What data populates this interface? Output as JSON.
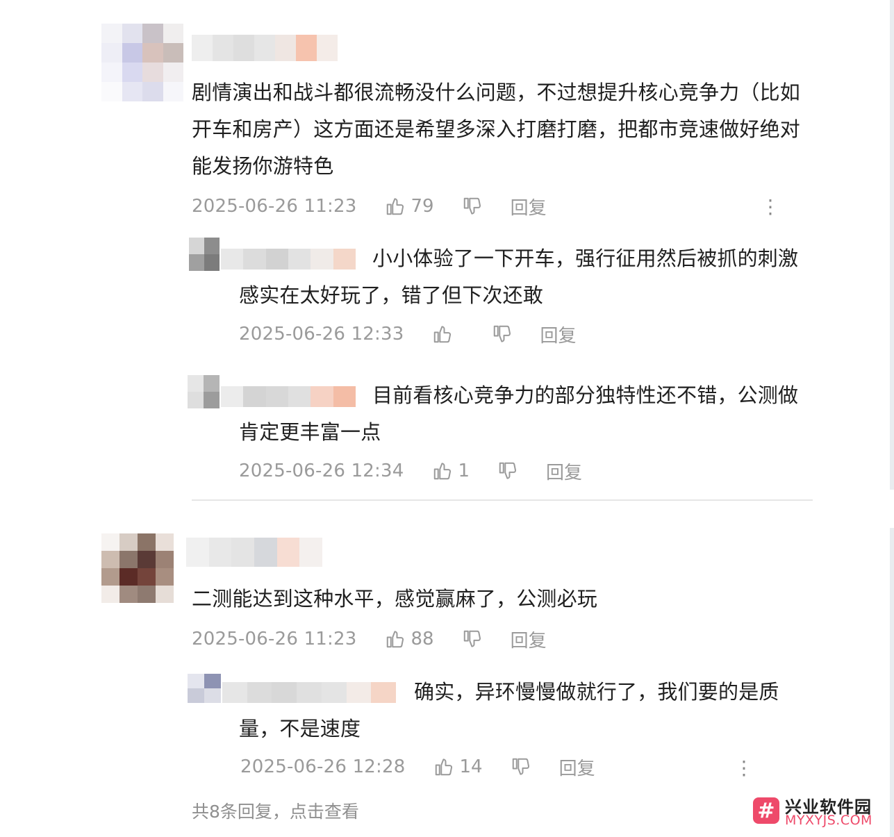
{
  "comments": [
    {
      "text": "剧情演出和战斗都很流畅没什么问题，不过想提升核心竞争力（比如开车和房产）这方面还是希望多深入打磨打磨，把都市竞速做好绝对能发扬你游特色",
      "time": "2025-06-26 11:23",
      "likes": "79",
      "reply_label": "回复",
      "more_label": "⋮",
      "replies": [
        {
          "text": "小小体验了一下开车，强行征用然后被抓的刺激感实在太好玩了，错了但下次还敢",
          "time": "2025-06-26 12:33",
          "likes": "",
          "reply_label": "回复"
        },
        {
          "text": "目前看核心竞争力的部分独特性还不错，公测做肯定更丰富一点",
          "time": "2025-06-26 12:34",
          "likes": "1",
          "reply_label": "回复"
        }
      ]
    },
    {
      "text": "二测能达到这种水平，感觉赢麻了，公测必玩",
      "time": "2025-06-26 11:23",
      "likes": "88",
      "reply_label": "回复",
      "replies": [
        {
          "text": "确实，异环慢慢做就行了，我们要的是质量，不是速度",
          "time": "2025-06-26 12:28",
          "likes": "14",
          "reply_label": "回复",
          "more_label": "⋮"
        }
      ],
      "view_more": "共8条回复，点击查看"
    }
  ],
  "watermark": {
    "logo_glyph": "#",
    "title": "兴业软件园",
    "url": "MYXYJS.COM"
  },
  "colors": {
    "text": "#1f1f1f",
    "meta": "#9a9a9a",
    "divider": "#e6e6e6",
    "watermark_accent": "#ee4a6a"
  },
  "icons": [
    "thumb-up-icon",
    "thumb-down-icon",
    "more-vertical-icon"
  ]
}
